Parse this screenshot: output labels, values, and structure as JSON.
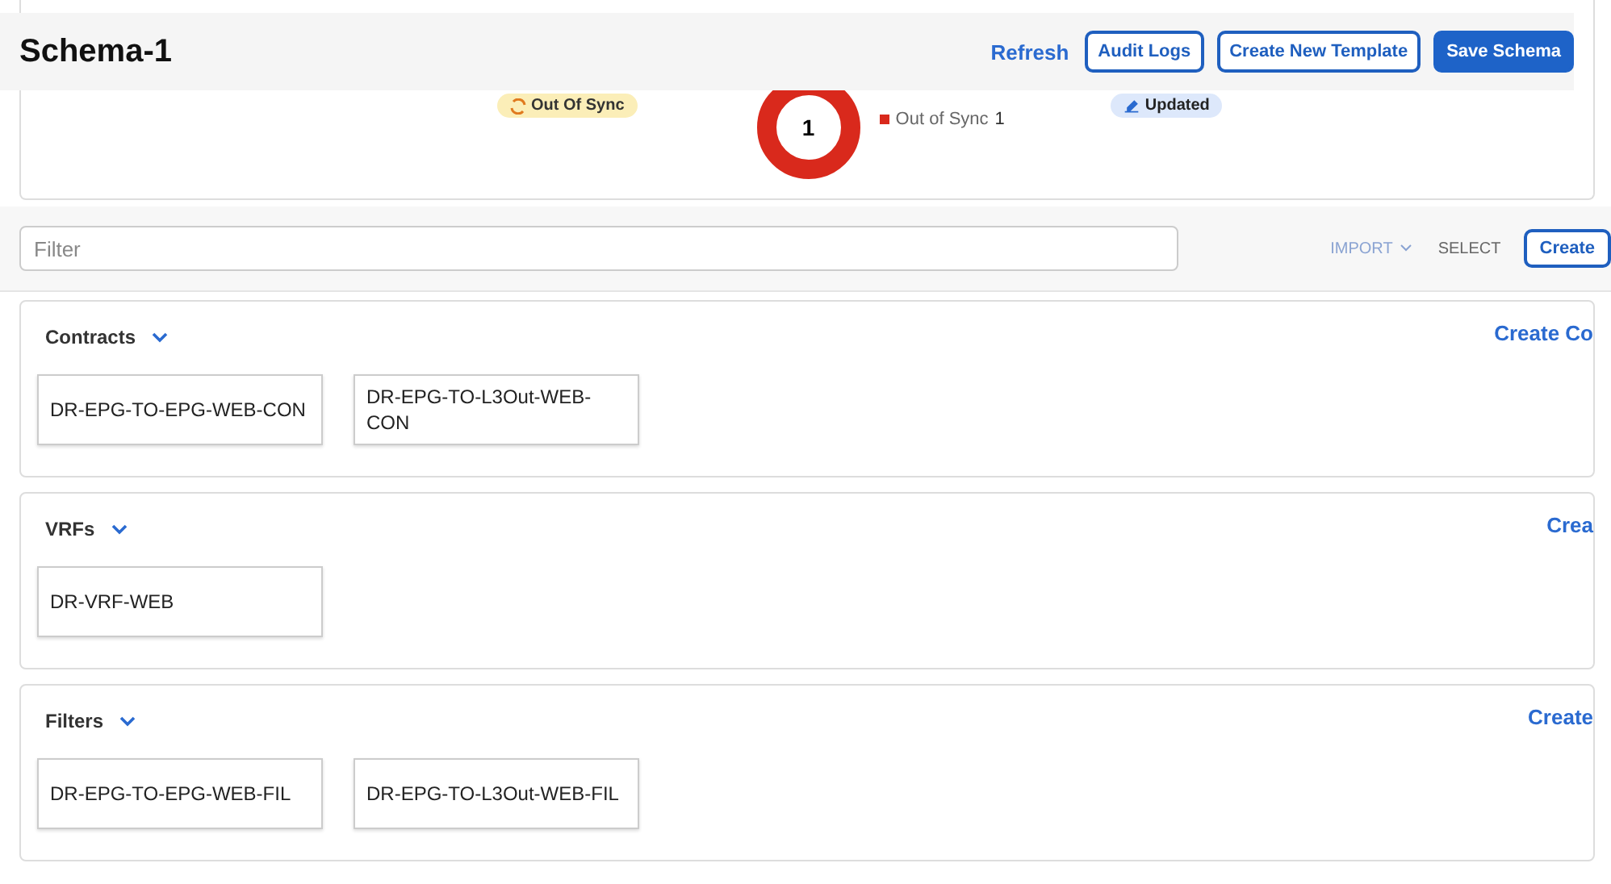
{
  "header": {
    "title": "Schema-1",
    "refresh": "Refresh",
    "buttons": [
      {
        "label": "Audit Logs",
        "kind": "outline"
      },
      {
        "label": "Create New Template",
        "kind": "outline"
      },
      {
        "label": "Save Schema",
        "kind": "primary"
      }
    ]
  },
  "summary": {
    "sync_badge": "Out Of Sync",
    "donut_center": "1",
    "legend": [
      {
        "label": "Out of Sync",
        "count": "1",
        "color": "#d9291c"
      }
    ],
    "deploy_badge": "Updated"
  },
  "filter": {
    "placeholder": "Filter"
  },
  "toolbar": {
    "import": {
      "label": "IMPORT",
      "disabled": true
    },
    "select": {
      "label": "SELECT",
      "disabled": false
    },
    "create": "Create"
  },
  "sections": [
    {
      "title": "Contracts",
      "expanded": true,
      "create_link": "Create Co",
      "items": [
        "DR-EPG-TO-EPG-WEB-CON",
        "DR-EPG-TO-L3Out-WEB-CON"
      ]
    },
    {
      "title": "VRFs",
      "expanded": true,
      "create_link": "Crea",
      "items": [
        "DR-VRF-WEB"
      ]
    },
    {
      "title": "Filters",
      "expanded": true,
      "create_link": "Create",
      "items": [
        "DR-EPG-TO-EPG-WEB-FIL",
        "DR-EPG-TO-L3Out-WEB-FIL"
      ]
    }
  ]
}
